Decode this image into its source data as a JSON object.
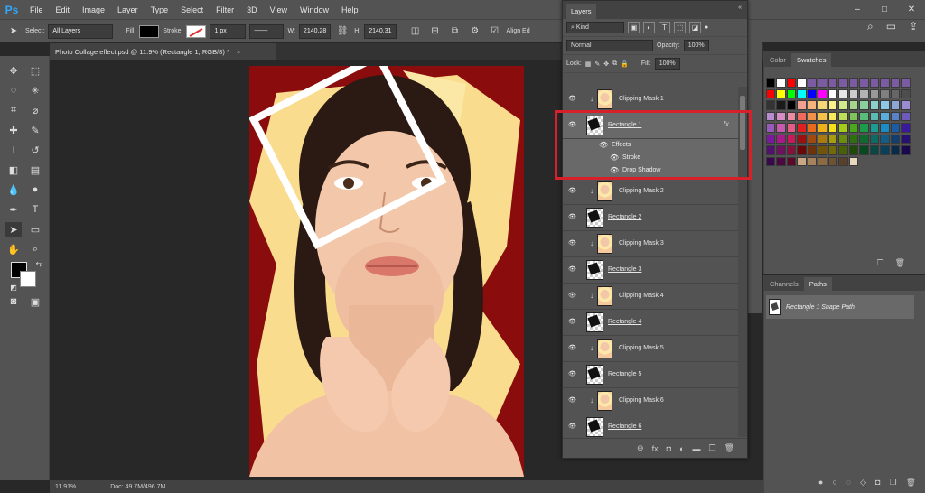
{
  "app": {
    "logo": "Ps"
  },
  "menu": [
    "File",
    "Edit",
    "Image",
    "Layer",
    "Type",
    "Select",
    "Filter",
    "3D",
    "View",
    "Window",
    "Help"
  ],
  "window_controls": {
    "minimize": "–",
    "maximize": "□",
    "close": "✕"
  },
  "options": {
    "select_label": "Select:",
    "select_value": "All Layers",
    "fill_label": "Fill:",
    "stroke_label": "Stroke:",
    "stroke_width": "1 px",
    "w_label": "W:",
    "w_value": "2140.28",
    "h_label": "H:",
    "h_value": "2140.31",
    "align_edges": "Align Ed",
    "fill_color": "#000000"
  },
  "document": {
    "tab_title": "Photo Collage effect.psd @ 11.9% (Rectangle 1, RGB/8) *",
    "tab_close": "×"
  },
  "status": {
    "zoom": "11.91%",
    "doc": "Doc: 49.7M/496.7M"
  },
  "layers_panel": {
    "title": "Layers",
    "kind_label": "Kind",
    "blend_mode": "Normal",
    "opacity_label": "Opacity:",
    "opacity_value": "100%",
    "lock_label": "Lock:",
    "fill_label": "Fill:",
    "fill_value": "100%",
    "layers": [
      {
        "name": "Clipping Mask 1",
        "kind": "clip"
      },
      {
        "name": "Rectangle 1",
        "kind": "shape",
        "selected": true,
        "fx": "fx"
      },
      {
        "name": "Clipping Mask 2",
        "kind": "clip"
      },
      {
        "name": "Rectangle 2",
        "kind": "shape"
      },
      {
        "name": "Clipping Mask 3",
        "kind": "clip"
      },
      {
        "name": "Rectangle 3",
        "kind": "shape"
      },
      {
        "name": "Clipping Mask 4",
        "kind": "clip"
      },
      {
        "name": "Rectangle 4",
        "kind": "shape"
      },
      {
        "name": "Clipping Mask 5",
        "kind": "clip"
      },
      {
        "name": "Rectangle 5",
        "kind": "shape"
      },
      {
        "name": "Clipping Mask 6",
        "kind": "clip"
      },
      {
        "name": "Rectangle 6",
        "kind": "shape"
      }
    ],
    "effects": {
      "label": "Effects",
      "items": [
        "Stroke",
        "Drop Shadow"
      ]
    },
    "footer_icons": [
      "link-icon",
      "fx-icon",
      "mask-icon",
      "adjustment-icon",
      "group-icon",
      "new-layer-icon",
      "trash-icon"
    ],
    "footer_glyphs": [
      "⊖",
      "fx",
      "◘",
      "◐",
      "▬",
      "❐",
      "🗑"
    ]
  },
  "color_panel": {
    "tabs": [
      "Color",
      "Swatches"
    ],
    "active_tab": "Swatches",
    "swatches": [
      "#000000",
      "#ffffff",
      "#ff0000",
      "#ffffff",
      "#7b5ca3",
      "#7b5ca3",
      "#7b5ca3",
      "#7b5ca3",
      "#7b5ca3",
      "#7b5ca3",
      "#7b5ca3",
      "#7b5ca3",
      "#7b5ca3",
      "#7b5ca3",
      "#ff0000",
      "#ffff00",
      "#00ff00",
      "#00ffff",
      "#0000ff",
      "#ff00ff",
      "#ffffff",
      "#e6e6e6",
      "#cccccc",
      "#b3b3b3",
      "#999999",
      "#808080",
      "#666666",
      "#4d4d4d",
      "#333333",
      "#1a1a1a",
      "#000000",
      "#f0a090",
      "#f5b27a",
      "#f7d67a",
      "#faf08c",
      "#d2ea8c",
      "#a6d68c",
      "#8ccf9e",
      "#8cd0c8",
      "#8cc8e6",
      "#8ca6d8",
      "#9a8cd0",
      "#b98cd0",
      "#d88cc6",
      "#ec8ca4",
      "#ee6a5a",
      "#f2924a",
      "#f7c24a",
      "#f8ea5a",
      "#bede5a",
      "#7ec45a",
      "#5abc7a",
      "#5abcb2",
      "#5aaede",
      "#5a82c6",
      "#6e5abc",
      "#9a5abc",
      "#c65aac",
      "#e65a86",
      "#e02020",
      "#e86a1a",
      "#f0b01a",
      "#f5e01a",
      "#a6cc1a",
      "#4aa81a",
      "#1a9c4a",
      "#1a9c92",
      "#1a8cc8",
      "#1a5ca8",
      "#3a1a9c",
      "#7a1a9c",
      "#a81a8a",
      "#c81a5a",
      "#9c1010",
      "#a04a10",
      "#a87a10",
      "#a89c10",
      "#6a8c10",
      "#2e7010",
      "#106a30",
      "#106a64",
      "#105e88",
      "#103e70",
      "#261070",
      "#521070",
      "#701060",
      "#88103c",
      "#6a0808",
      "#6e3208",
      "#725408",
      "#726a08",
      "#486008",
      "#1e4c08",
      "#084820",
      "#084844",
      "#08405c",
      "#082a4c",
      "#1a084c",
      "#38084c",
      "#4c0840",
      "#5c0828",
      "#c8a882",
      "#a6835c",
      "#8c6a44",
      "#6e5234",
      "#58402a",
      "#e8d8c0"
    ]
  },
  "channels_panel": {
    "tabs": [
      "Channels",
      "Paths"
    ],
    "active_tab": "Paths",
    "paths": [
      "Rectangle 1 Shape Path"
    ]
  },
  "accent": "#d8202a"
}
